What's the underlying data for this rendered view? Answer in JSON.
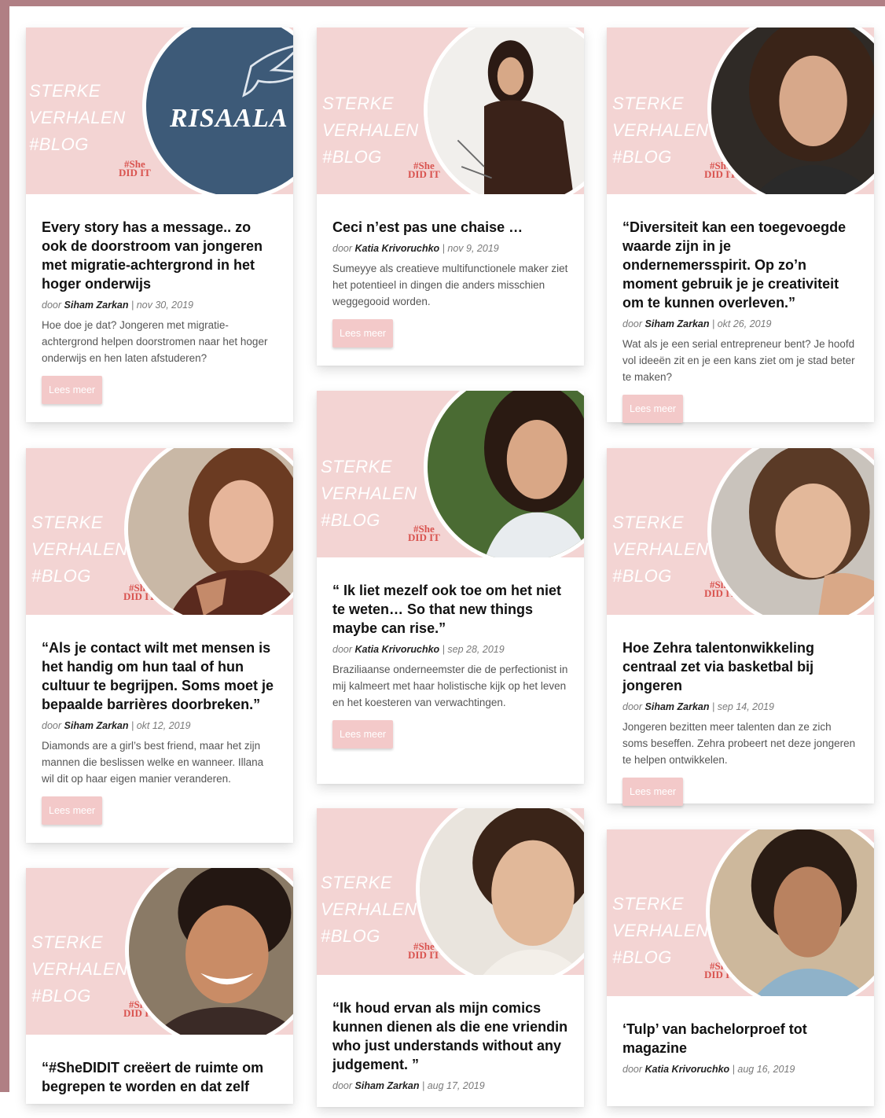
{
  "banner": {
    "line1": "STERKE",
    "line2": "VERHALEN",
    "line3": "#BLOG"
  },
  "logo": {
    "line1": "#She",
    "line2": "DID IT"
  },
  "read_more": "Lees meer",
  "by_prefix": "door",
  "colors": {
    "frame": "#b07f84",
    "banner_bg": "#f3d4d3",
    "button_bg": "#f3c9c9",
    "logo": "#d9534f"
  },
  "cards": [
    {
      "title": "Every story has a message.. zo ook de doorstroom van jongeren met migratie-achtergrond in het hoger onderwijs",
      "author": "Siham Zarkan",
      "date": "nov 30, 2019",
      "excerpt": "Hoe doe je dat? Jongeren met migratie-achtergrond helpen doorstromen naar het hoger onderwijs en hen laten afstuderen?",
      "image_text": "RISAALA"
    },
    {
      "title": "Ceci n’est pas une chaise …",
      "author": "Katia Krivoruchko",
      "date": "nov 9, 2019",
      "excerpt": "Sumeyye als creatieve multifunctionele maker ziet het potentieel in dingen die anders misschien weggegooid worden."
    },
    {
      "title": "“Diversiteit kan een toegevoegde waarde zijn in je ondernemersspirit. Op zo’n moment gebruik je je creativiteit om te kunnen overleven.”",
      "author": "Siham Zarkan",
      "date": "okt 26, 2019",
      "excerpt": "Wat als je een serial entrepreneur bent? Je hoofd vol ideeën zit en je een kans ziet om je stad beter te maken?"
    },
    {
      "title": "“Als je contact wilt met mensen is het handig om hun taal of hun cultuur te begrijpen. Soms moet je bepaalde barrières doorbreken.”",
      "author": "Siham Zarkan",
      "date": "okt 12, 2019",
      "excerpt": "Diamonds are a girl’s best friend, maar het zijn mannen die beslissen welke en wanneer. Illana wil dit op haar eigen manier veranderen."
    },
    {
      "title": "“ Ik liet mezelf ook toe om het niet te weten… So that new things maybe can rise.”",
      "author": "Katia Krivoruchko",
      "date": "sep 28, 2019",
      "excerpt": "Braziliaanse onderneemster die de perfectionist in mij kalmeert met haar holistische kijk op het leven en het koesteren van verwachtingen."
    },
    {
      "title": "Hoe Zehra talentonwikkeling centraal zet via basketbal bij jongeren",
      "author": "Siham Zarkan",
      "date": "sep 14, 2019",
      "excerpt": "Jongeren bezitten meer talenten dan ze zich soms beseffen. Zehra probeert net deze jongeren te helpen ontwikkelen."
    },
    {
      "title": "“#SheDIDIT creëert de ruimte om begrepen te worden en dat zelf"
    },
    {
      "title": "“Ik houd ervan als mijn comics kunnen dienen als die ene vriendin who just understands without any judgement. ”",
      "author": "Siham Zarkan",
      "date": "aug 17, 2019"
    },
    {
      "title": "‘Tulp’ van bachelorproef tot magazine",
      "author": "Katia Krivoruchko",
      "date": "aug 16, 2019"
    }
  ]
}
